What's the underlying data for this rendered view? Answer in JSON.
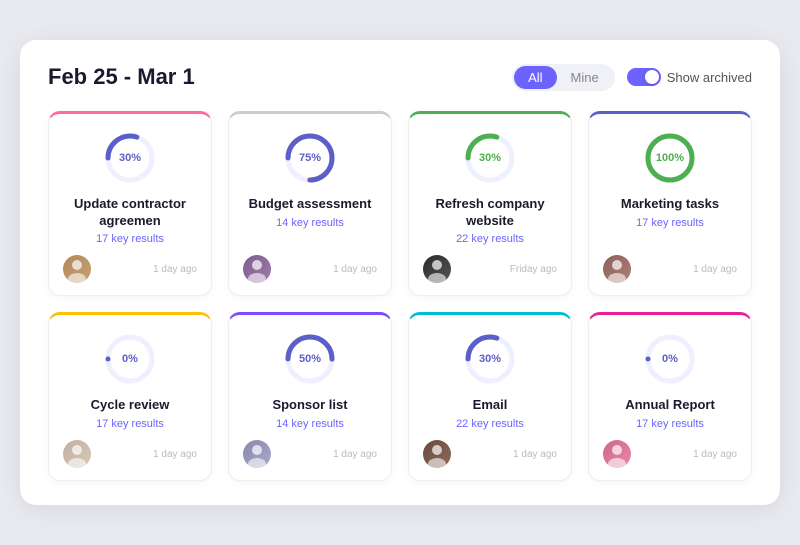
{
  "header": {
    "title": "Feb 25 - Mar 1",
    "filter": {
      "all_label": "All",
      "mine_label": "Mine",
      "show_archived_label": "Show archived"
    }
  },
  "cards": [
    {
      "id": 1,
      "title": "Update contractor agreemen",
      "subtitle": "17 key results",
      "progress": 30,
      "time": "1 day ago",
      "border": "pink",
      "avatar_class": "av1"
    },
    {
      "id": 2,
      "title": "Budget assessment",
      "subtitle": "14 key results",
      "progress": 75,
      "time": "1 day ago",
      "border": "gray",
      "avatar_class": "av2"
    },
    {
      "id": 3,
      "title": "Refresh company website",
      "subtitle": "22 key results",
      "progress": 30,
      "time": "Friday ago",
      "border": "green",
      "avatar_class": "av3"
    },
    {
      "id": 4,
      "title": "Marketing tasks",
      "subtitle": "17 key results",
      "progress": 100,
      "time": "1 day ago",
      "border": "blue",
      "avatar_class": "av4"
    },
    {
      "id": 5,
      "title": "Cycle review",
      "subtitle": "17 key results",
      "progress": 0,
      "time": "1 day ago",
      "border": "yellow",
      "avatar_class": "av5"
    },
    {
      "id": 6,
      "title": "Sponsor list",
      "subtitle": "14 key results",
      "progress": 50,
      "time": "1 day ago",
      "border": "purple",
      "avatar_class": "av6"
    },
    {
      "id": 7,
      "title": "Email",
      "subtitle": "22 key results",
      "progress": 30,
      "time": "1 day ago",
      "border": "cyan",
      "avatar_class": "av7"
    },
    {
      "id": 8,
      "title": "Annual Report",
      "subtitle": "17 key results",
      "progress": 0,
      "time": "1 day ago",
      "border": "magenta",
      "avatar_class": "av8"
    }
  ]
}
